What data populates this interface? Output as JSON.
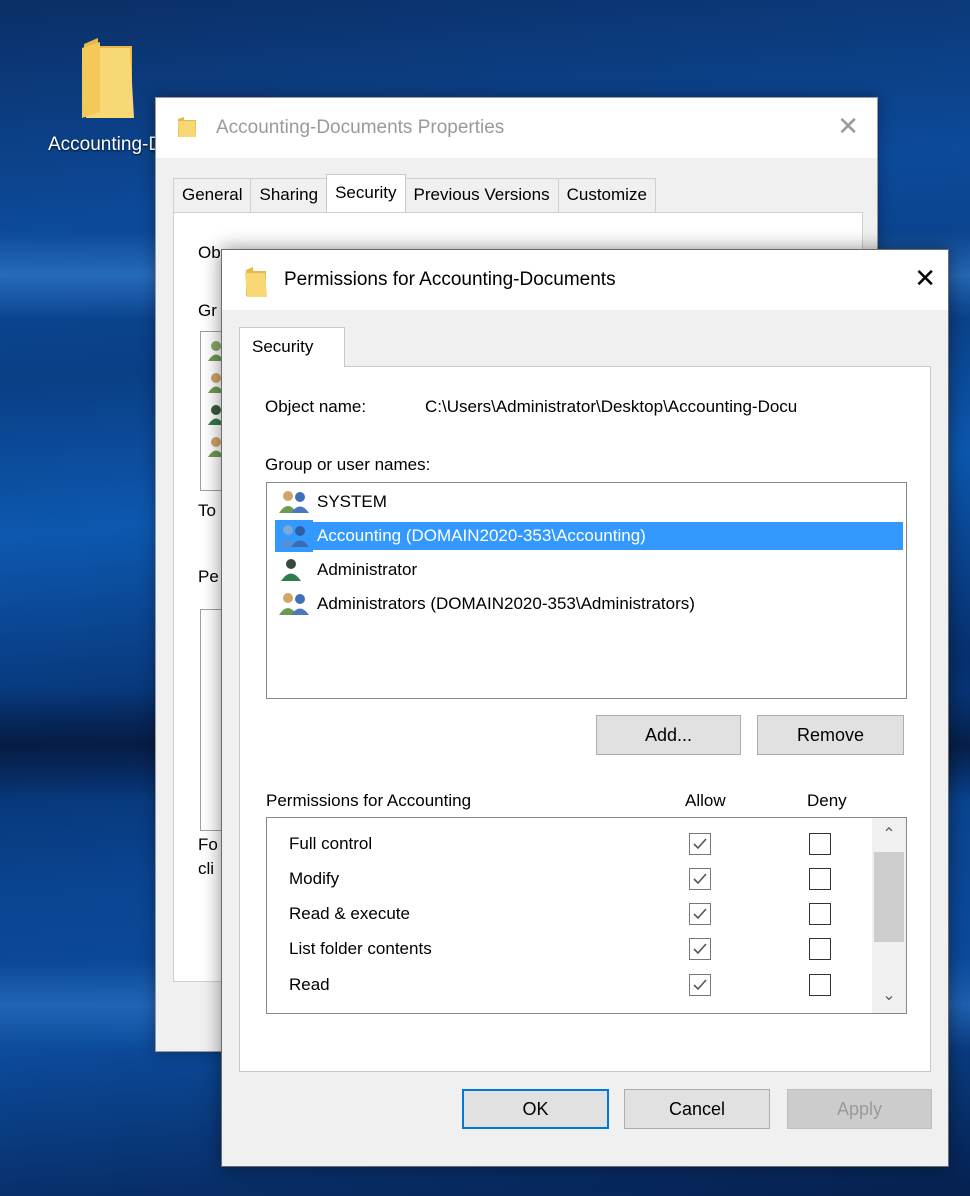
{
  "desktop": {
    "icon_label": "Accounting-Documents"
  },
  "properties_window": {
    "title": "Accounting-Documents Properties",
    "tabs": [
      {
        "label": "General"
      },
      {
        "label": "Sharing"
      },
      {
        "label": "Security"
      },
      {
        "label": "Previous Versions"
      },
      {
        "label": "Customize"
      }
    ],
    "active_tab": "Security",
    "fragments": {
      "object_name_partial": "Ob",
      "group_partial": "Gr",
      "to_partial": "To",
      "perm_partial": "Pe",
      "for_partial": "Fo",
      "click_partial": "cli"
    }
  },
  "permissions_dialog": {
    "title": "Permissions for Accounting-Documents",
    "tab_label": "Security",
    "object_name_label": "Object name:",
    "object_name_value": "C:\\Users\\Administrator\\Desktop\\Accounting-Docu",
    "group_label": "Group or user names:",
    "users": [
      {
        "name": "SYSTEM",
        "icon": "group-users-icon",
        "selected": false
      },
      {
        "name": "Accounting (DOMAIN2020-353\\Accounting)",
        "icon": "group-users-icon",
        "selected": true
      },
      {
        "name": "Administrator",
        "icon": "single-user-icon",
        "selected": false
      },
      {
        "name": "Administrators (DOMAIN2020-353\\Administrators)",
        "icon": "group-users-icon",
        "selected": false
      }
    ],
    "add_button": "Add...",
    "remove_button": "Remove",
    "permissions_header": "Permissions for Accounting",
    "allow_header": "Allow",
    "deny_header": "Deny",
    "permissions": [
      {
        "name": "Full control",
        "allow": true,
        "deny": false
      },
      {
        "name": "Modify",
        "allow": true,
        "deny": false
      },
      {
        "name": "Read & execute",
        "allow": true,
        "deny": false
      },
      {
        "name": "List folder contents",
        "allow": true,
        "deny": false
      },
      {
        "name": "Read",
        "allow": true,
        "deny": false
      }
    ],
    "ok_button": "OK",
    "cancel_button": "Cancel",
    "apply_button": "Apply"
  },
  "colors": {
    "selection": "#3399ff",
    "primary_border": "#0078d7",
    "folder_yellow": "#f8d775"
  }
}
